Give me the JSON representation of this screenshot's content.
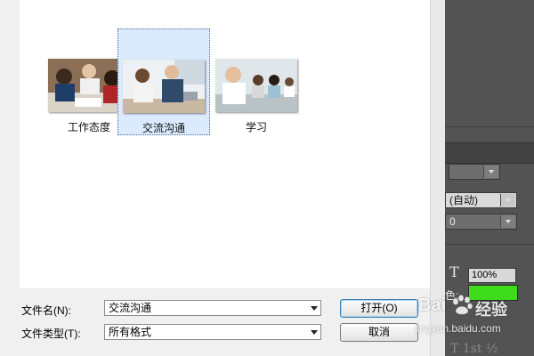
{
  "dialog": {
    "items": [
      {
        "label": "工作态度",
        "thumbnail": "team-meeting-photo",
        "selected": false
      },
      {
        "label": "交流沟通",
        "thumbnail": "office-conversation-photo",
        "selected": true
      },
      {
        "label": "学习",
        "thumbnail": "classroom-students-photo",
        "selected": false
      }
    ],
    "filename_label": "文件名(N):",
    "filename_value": "交流沟通",
    "filetype_label": "文件类型(T):",
    "filetype_value": "所有格式",
    "open_button": "打开(O)",
    "cancel_button": "取消"
  },
  "panel": {
    "leading_value": "(自动)",
    "tracking_value": "0",
    "scale_value": "100%",
    "color_label": "色:",
    "color_value": "#3fdc1c"
  },
  "watermark": {
    "brand": "Bai",
    "brand_suffix": "经验",
    "url": "jingyan.baidu.com"
  }
}
